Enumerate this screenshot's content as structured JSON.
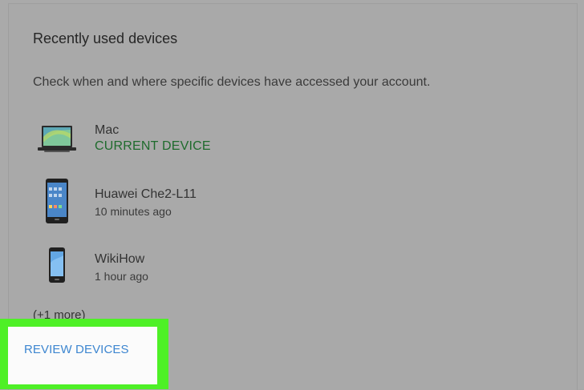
{
  "panel": {
    "title": "Recently used devices",
    "description": "Check when and where specific devices have accessed your account."
  },
  "devices": [
    {
      "name": "Mac",
      "status": "CURRENT DEVICE",
      "icon": "laptop-icon"
    },
    {
      "name": "Huawei Che2-L11",
      "status": "10 minutes ago",
      "icon": "smartphone-icon"
    },
    {
      "name": "WikiHow",
      "status": "1 hour ago",
      "icon": "phone-icon"
    }
  ],
  "more_text": "(+1 more)",
  "review_button": "REVIEW DEVICES",
  "colors": {
    "background": "#aaaaaa",
    "current_device": "#1f6b2d",
    "link": "#3d86d0",
    "highlight": "#4ef026"
  }
}
